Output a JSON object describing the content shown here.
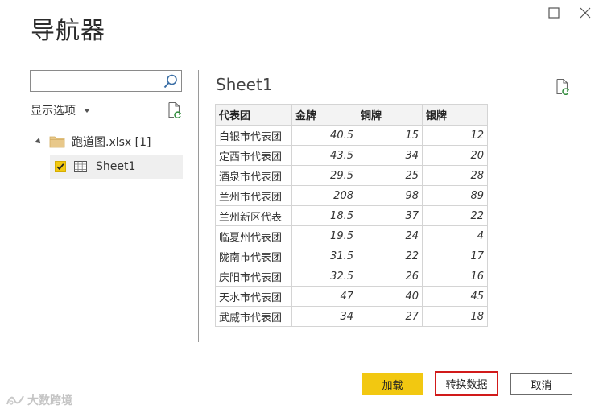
{
  "window": {
    "title": "导航器",
    "maximize_icon": "maximize-icon",
    "close_icon": "close-icon"
  },
  "left_panel": {
    "search": {
      "value": "",
      "placeholder": "",
      "icon": "search-icon"
    },
    "display_options_label": "显示选项",
    "refresh_icon": "refresh-icon",
    "tree": {
      "folder": {
        "label": "跑道图.xlsx [1]",
        "expanded": true,
        "icon": "folder-icon"
      },
      "items": [
        {
          "label": "Sheet1",
          "checked": true,
          "icon": "sheet-icon",
          "selected": true
        }
      ]
    }
  },
  "preview": {
    "title": "Sheet1",
    "refresh_icon": "refresh-icon",
    "table": {
      "headers": [
        "代表团",
        "金牌",
        "铜牌",
        "银牌"
      ],
      "rows": [
        [
          "白银市代表团",
          "40.5",
          "15",
          "12"
        ],
        [
          "定西市代表团",
          "43.5",
          "34",
          "20"
        ],
        [
          "酒泉市代表团",
          "29.5",
          "25",
          "28"
        ],
        [
          "兰州市代表团",
          "208",
          "98",
          "89"
        ],
        [
          "兰州新区代表",
          "18.5",
          "37",
          "22"
        ],
        [
          "临夏州代表团",
          "19.5",
          "24",
          "4"
        ],
        [
          "陇南市代表团",
          "31.5",
          "22",
          "17"
        ],
        [
          "庆阳市代表团",
          "32.5",
          "26",
          "16"
        ],
        [
          "天水市代表团",
          "47",
          "40",
          "45"
        ],
        [
          "武威市代表团",
          "34",
          "27",
          "18"
        ]
      ]
    }
  },
  "buttons": {
    "load": "加载",
    "transform": "转换数据",
    "cancel": "取消"
  },
  "colors": {
    "accent_yellow": "#f2c811",
    "highlight_red": "#d11a1a",
    "selected_bg": "#efefef",
    "header_bg": "#f3f3f3"
  },
  "watermark": {
    "text": "大数跨境"
  }
}
